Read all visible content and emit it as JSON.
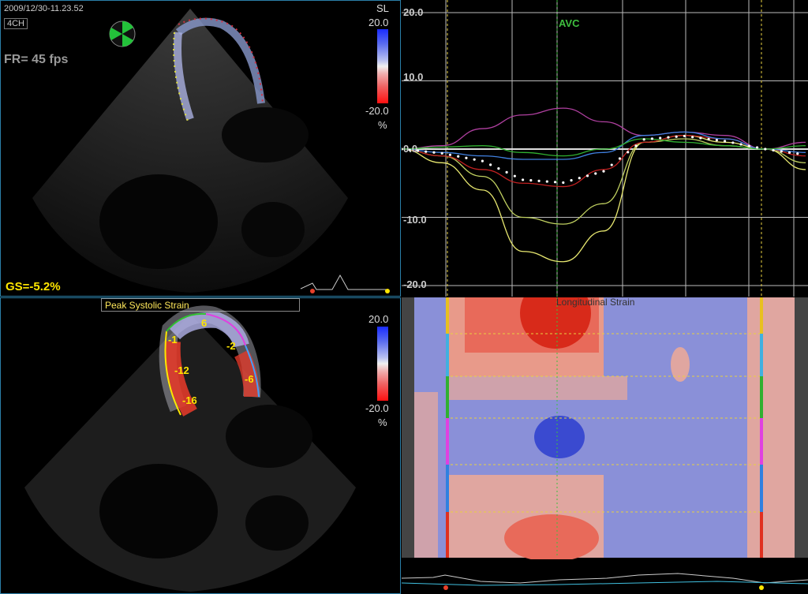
{
  "top_left": {
    "timestamp": "2009/12/30-11.23.52",
    "view": "4CH",
    "frame_rate": "FR=  45 fps",
    "scale": {
      "label": "SL",
      "max": "20.0",
      "min": "-20.0",
      "unit": "%"
    },
    "global_strain": "GS=-5.2%"
  },
  "bottom_left": {
    "title": "Peak Systolic Strain",
    "scale": {
      "max": "20.0",
      "min": "-20.0",
      "unit": "%"
    },
    "segment_values": [
      "6",
      "-1",
      "-2",
      "-12",
      "-6",
      "-16"
    ]
  },
  "top_right": {
    "event_label": "AVC",
    "y_ticks": [
      "20.0",
      "10.0",
      "0.0",
      "-10.0",
      "-20.0"
    ]
  },
  "bottom_right": {
    "title": "Longitudinal Strain"
  },
  "colors": {
    "accent": "#2a7fa8",
    "label_yellow": "#ffe600",
    "avc_green": "#3fbf3f",
    "negative_strain": "#e8503a",
    "positive_strain": "#4a55d8"
  },
  "chart_data": {
    "type": "line",
    "ylim": [
      -20,
      20
    ],
    "series": [
      {
        "values": [
          0,
          -2,
          -6,
          -15,
          -16.5,
          -12,
          1,
          2,
          1,
          0,
          -3
        ]
      },
      {
        "values": [
          0,
          -1,
          -4,
          -10,
          -11,
          -8,
          1,
          1.5,
          0.5,
          0,
          -2
        ]
      },
      {
        "values": [
          0,
          0.5,
          3,
          5,
          6,
          4,
          2,
          2.5,
          2,
          0,
          1
        ]
      },
      {
        "values": [
          0,
          -1,
          -3,
          -5,
          -5.5,
          -3,
          1,
          2,
          1.5,
          0,
          -1
        ]
      },
      {
        "values": [
          0,
          -0.5,
          -1,
          -1.5,
          -1.5,
          -0.5,
          2,
          2.5,
          1.5,
          0,
          -0.5
        ]
      },
      {
        "values": [
          0,
          0.3,
          0.5,
          -0.5,
          -1,
          0,
          1.5,
          1,
          0.5,
          0,
          0.5
        ]
      }
    ]
  }
}
